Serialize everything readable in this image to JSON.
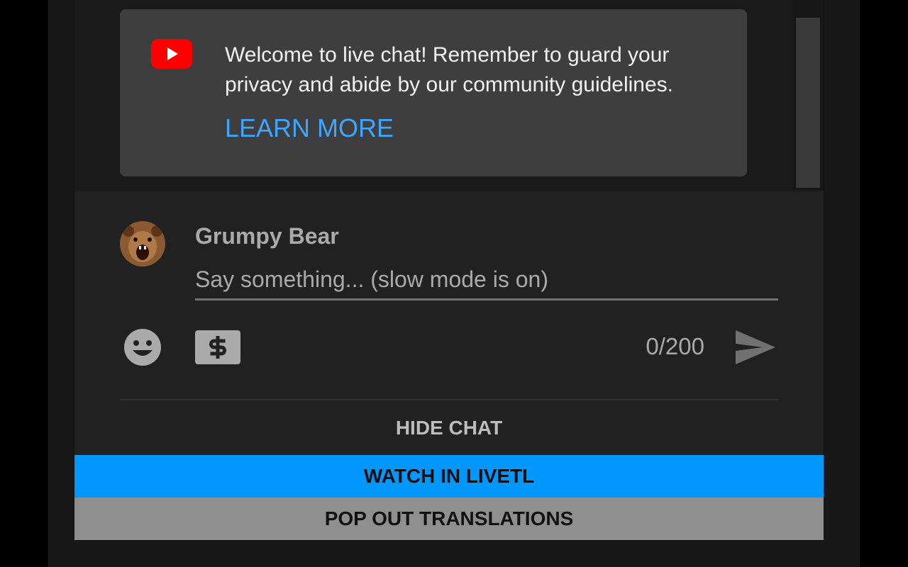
{
  "welcome": {
    "message": "Welcome to live chat! Remember to guard your privacy and abide by our community guidelines.",
    "learn_more_label": "LEARN MORE",
    "logo_icon": "youtube-logo-icon"
  },
  "composer": {
    "username": "Grumpy Bear",
    "input_value": "",
    "input_placeholder": "Say something... (slow mode is on)",
    "char_count": "0/200",
    "emoji_icon": "emoji-icon",
    "super_chat_icon": "dollar-icon",
    "send_icon": "send-icon"
  },
  "actions": {
    "hide_chat_label": "HIDE CHAT",
    "watch_label": "WATCH IN LIVETL",
    "popout_label": "POP OUT TRANSLATIONS"
  },
  "colors": {
    "accent_blue": "#0297fd",
    "link_blue": "#3ea6ff",
    "youtube_red": "#ff0000"
  }
}
